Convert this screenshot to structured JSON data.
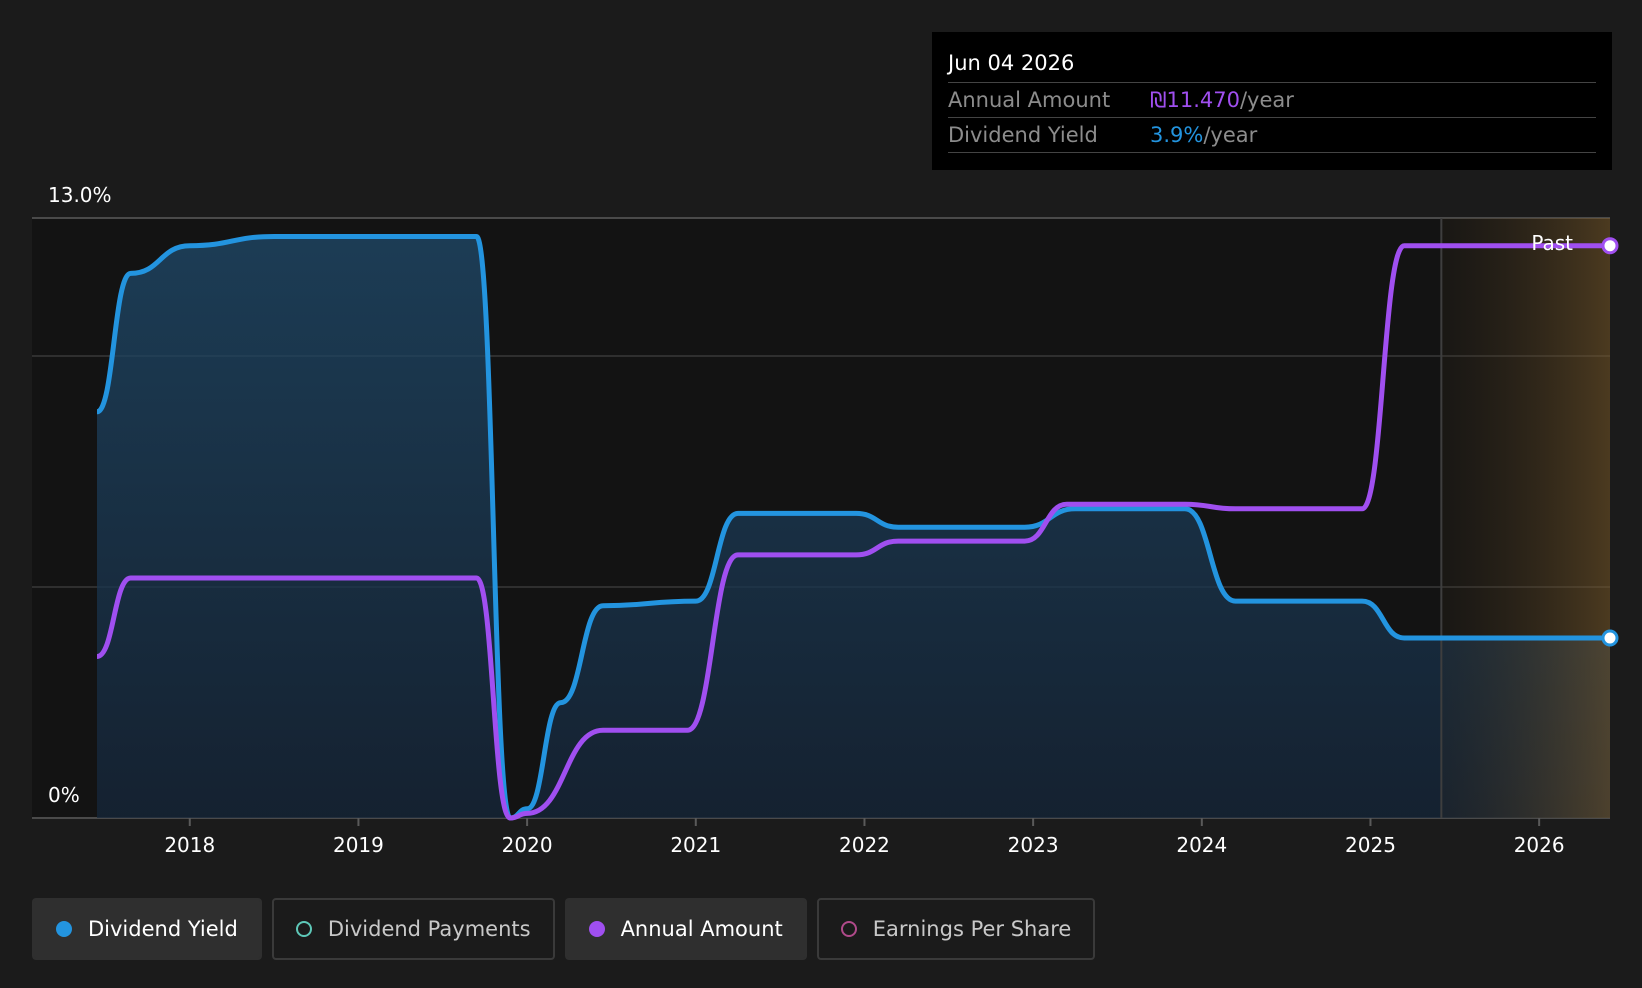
{
  "tooltip": {
    "date": "Jun 04 2026",
    "rows": [
      {
        "label": "Annual Amount",
        "value": "₪11.470",
        "unit": "/year",
        "color": "#a04ff0"
      },
      {
        "label": "Dividend Yield",
        "value": "3.9%",
        "unit": "/year",
        "color": "#2394df"
      }
    ]
  },
  "legend": [
    {
      "label": "Dividend Yield",
      "color": "#2394df",
      "style": "filled",
      "active": true
    },
    {
      "label": "Dividend Payments",
      "color": "#5ec8b8",
      "style": "hollow",
      "active": false
    },
    {
      "label": "Annual Amount",
      "color": "#a04ff0",
      "style": "filled",
      "active": true
    },
    {
      "label": "Earnings Per Share",
      "color": "#b04a8a",
      "style": "hollow",
      "active": false
    }
  ],
  "chart_data": {
    "type": "line",
    "y_top_label": "13.0%",
    "y_bottom_label": "0%",
    "ylim": [
      0,
      13.0
    ],
    "xlim": [
      2017.45,
      2026.42
    ],
    "x_ticks": [
      "2018",
      "2019",
      "2020",
      "2021",
      "2022",
      "2023",
      "2024",
      "2025",
      "2026"
    ],
    "past_label": "Past",
    "forecast_start": 2025.42,
    "grid": true,
    "series": [
      {
        "name": "Dividend Yield",
        "color": "#2394df",
        "fill": true,
        "x": [
          2017.45,
          2017.65,
          2018.0,
          2018.5,
          2019.0,
          2019.5,
          2019.7,
          2019.9,
          2020.0,
          2020.2,
          2020.45,
          2021.0,
          2021.25,
          2021.95,
          2022.2,
          2022.95,
          2023.25,
          2023.9,
          2024.2,
          2024.95,
          2025.2,
          2026.42
        ],
        "y": [
          8.8,
          11.8,
          12.4,
          12.6,
          12.6,
          12.6,
          12.6,
          0.0,
          0.2,
          2.5,
          4.6,
          4.7,
          6.6,
          6.6,
          6.3,
          6.3,
          6.7,
          6.7,
          4.7,
          4.7,
          3.9,
          3.9
        ]
      },
      {
        "name": "Annual Amount",
        "color": "#a04ff0",
        "fill": false,
        "x": [
          2017.45,
          2017.65,
          2018.0,
          2019.0,
          2019.7,
          2019.9,
          2020.0,
          2020.45,
          2020.95,
          2021.25,
          2021.95,
          2022.2,
          2022.95,
          2023.2,
          2023.9,
          2024.2,
          2024.95,
          2025.2,
          2026.42
        ],
        "y": [
          3.5,
          5.2,
          5.2,
          5.2,
          5.2,
          0.0,
          0.1,
          1.9,
          1.9,
          5.7,
          5.7,
          6.0,
          6.0,
          6.8,
          6.8,
          6.7,
          6.7,
          12.4,
          12.4
        ]
      }
    ]
  }
}
